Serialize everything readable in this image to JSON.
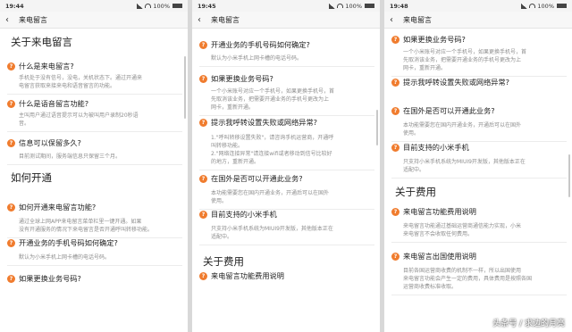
{
  "screens": [
    {
      "status": {
        "time": "19:44",
        "battery": "100%"
      },
      "title": "来电留言",
      "items": [
        {
          "kind": "sec",
          "text": "关于来电留言"
        },
        {
          "kind": "q",
          "text": "什么是来电留言?"
        },
        {
          "kind": "a",
          "lines": [
            "手机处于没有信号，没电，关机状态下。通过开通来",
            "电留言获取来接来电和语音留言的功能。"
          ]
        },
        {
          "kind": "q",
          "text": "什么是语音留言功能?"
        },
        {
          "kind": "a",
          "lines": [
            "主叫用户通过语音提示可以为被叫用户录制20秒语",
            "音。"
          ]
        },
        {
          "kind": "q",
          "text": "信息可以保留多久?"
        },
        {
          "kind": "a",
          "lines": [
            "目前测试期间，服务端信息只保留三个月。"
          ]
        },
        {
          "kind": "sec",
          "text": "如何开通"
        },
        {
          "kind": "q",
          "text": "如何开通来电留言功能?"
        },
        {
          "kind": "a",
          "lines": [
            "通过全球上网APP来电留言菜单栏里一键开通。如果",
            "没有开通服务的情况下来电留言是否开通呼叫转移功能。"
          ]
        },
        {
          "kind": "q",
          "text": "开通业务的手机号码如何确定?"
        },
        {
          "kind": "a",
          "lines": [
            "默认为小米手机上网卡槽的电话号码。"
          ]
        },
        {
          "kind": "q",
          "text": "如果更换业务号码?"
        }
      ]
    },
    {
      "status": {
        "time": "19:45",
        "battery": "100%"
      },
      "title": "来电留言",
      "items": [
        {
          "kind": "q",
          "text": "开通业务的手机号码如何确定?"
        },
        {
          "kind": "a",
          "lines": [
            "默认为小米手机上网卡槽的电话号码。"
          ]
        },
        {
          "kind": "q",
          "text": "如果更换业务号码?"
        },
        {
          "kind": "a",
          "lines": [
            "一个小米账号对应一个手机号，如果更换手机号，首",
            "先取消该业务，把需要开通业务的手机号更改为上",
            "网卡，重新开通。"
          ]
        },
        {
          "kind": "q",
          "text": "提示我呼转设置失败或网络异常?"
        },
        {
          "kind": "a",
          "lines": [
            "1.\"呼叫转移设置失败\"，请咨询手机运营商，开通呼",
            "叫转移功能。",
            "2.\"网络连接异常\"请连接wifi或者移动到信号比较好",
            "的地方，重新开通。"
          ]
        },
        {
          "kind": "q",
          "text": "在国外是否可以开通此业务?"
        },
        {
          "kind": "a",
          "lines": [
            "本功能需要您在国内开通业务，开通后可以在国外",
            "使用。"
          ]
        },
        {
          "kind": "q",
          "text": "目前支持的小米手机"
        },
        {
          "kind": "a",
          "lines": [
            "只支持小米手机系统为MIUI9开发版，其他版本正在",
            "适配中。"
          ]
        },
        {
          "kind": "sec",
          "text": "关于费用"
        },
        {
          "kind": "q",
          "text": "来电留言功能费用说明"
        }
      ]
    },
    {
      "status": {
        "time": "19:48",
        "battery": "100%"
      },
      "title": "来电留言",
      "items": [
        {
          "kind": "q",
          "text": "如果更换业务号码?"
        },
        {
          "kind": "a",
          "lines": [
            "一个小米账号对应一个手机号，如果更换手机号，首",
            "先取消该业务，把需要开通业务的手机号更改为上",
            "网卡，重新开通。"
          ]
        },
        {
          "kind": "q",
          "text": "提示我呼转设置失败或网络异常?"
        },
        {
          "kind": "q",
          "text": "在国外是否可以开通此业务?"
        },
        {
          "kind": "a",
          "lines": [
            "本功能需要您在国内开通业务，开通后可以在国外",
            "使用。"
          ]
        },
        {
          "kind": "q",
          "text": "目前支持的小米手机"
        },
        {
          "kind": "a",
          "lines": [
            "只支持小米手机系统为MIUI9开发版，其他版本正在",
            "适配中。"
          ]
        },
        {
          "kind": "sec",
          "text": "关于费用"
        },
        {
          "kind": "q",
          "text": "来电留言功能费用说明"
        },
        {
          "kind": "a",
          "lines": [
            "来电留言功能通过基础运营商通信能力实现，小米",
            "来电留言不会收取任何费用。"
          ]
        },
        {
          "kind": "q",
          "text": "来电留言出国使用说明"
        },
        {
          "kind": "a",
          "lines": [
            "目前各国运营商收费的机制不一样，所以出国使用",
            "来电留言功能会产生一定的费用，具体费用是按照各国",
            "运营商收费标准收取。"
          ]
        }
      ]
    }
  ],
  "watermark": "头条号 / 求边的月亮"
}
